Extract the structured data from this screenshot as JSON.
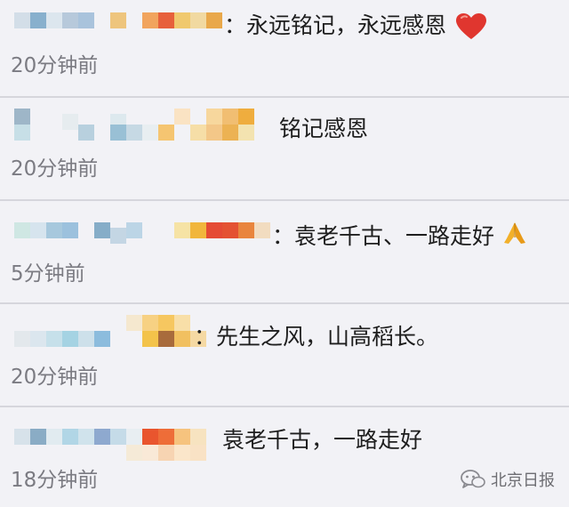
{
  "comments": [
    {
      "text": "：永远铭记，永远感恩",
      "time": "20分钟前",
      "icon": "heart-icon"
    },
    {
      "text": "铭记感恩",
      "time": "20分钟前"
    },
    {
      "text": "：袁老千古、一路走好",
      "time": "5分钟前",
      "icon": "praying-hands-icon"
    },
    {
      "text": "：先生之风，山高稻长。",
      "time": "20分钟前"
    },
    {
      "text": "袁老千古，一路走好",
      "time": "18分钟前"
    }
  ],
  "watermark": {
    "label": "北京日报",
    "icon": "wechat-logo-icon"
  },
  "colors": {
    "background": "#f2f2f6",
    "text": "#1e1e1e",
    "timestamp": "#7b7b82",
    "heart": "#e0362f",
    "divider": "#d6d6dc"
  }
}
